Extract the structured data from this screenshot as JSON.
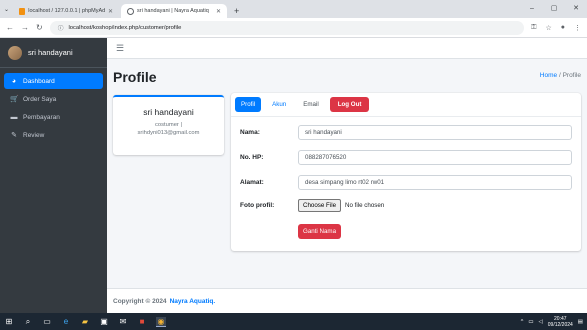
{
  "browser": {
    "tabs": [
      {
        "label": "localhost / 127.0.0.1 | phpMyAdmin",
        "active": false
      },
      {
        "label": "sri handayani | Nayra Aquatiq",
        "active": true
      }
    ],
    "url": "localhost/koshop/index.php/customer/profile"
  },
  "sidebar": {
    "user_name": "sri handayani",
    "items": [
      {
        "label": "Dashboard",
        "icon": "dashboard-icon",
        "active": true
      },
      {
        "label": "Order Saya",
        "icon": "cart-icon",
        "active": false
      },
      {
        "label": "Pembayaran",
        "icon": "payment-icon",
        "active": false
      },
      {
        "label": "Review",
        "icon": "edit-icon",
        "active": false
      }
    ]
  },
  "topnav": {
    "menu_icon": "hamburger-icon"
  },
  "page": {
    "title": "Profile",
    "breadcrumb_home": "Home",
    "breadcrumb_sep": "/",
    "breadcrumb_current": "Profile"
  },
  "profile_card": {
    "name": "sri handayani",
    "role": "costumer |",
    "email": "srihdyni013@gmail.com"
  },
  "form": {
    "tabs": [
      {
        "label": "Profil",
        "style": "active"
      },
      {
        "label": "Akun",
        "style": "link"
      },
      {
        "label": "Email",
        "style": "muted"
      },
      {
        "label": "Log Out",
        "style": "danger"
      }
    ],
    "fields": {
      "nama_label": "Nama:",
      "nama_value": "sri handayani",
      "hp_label": "No. HP:",
      "hp_value": "088287076520",
      "alamat_label": "Alamat:",
      "alamat_value": "desa simpang limo rt02 rw01",
      "foto_label": "Foto profil:",
      "choose_file": "Choose File",
      "no_file": "No file chosen"
    },
    "submit_label": "Ganti Nama"
  },
  "footer": {
    "copyright": "Copyright © 2024",
    "brand": "Nayra Aquatiq."
  },
  "taskbar": {
    "time": "20:47",
    "date": "09/12/2024"
  },
  "colors": {
    "primary": "#007bff",
    "danger": "#dc3545",
    "sidebar": "#343a40"
  }
}
